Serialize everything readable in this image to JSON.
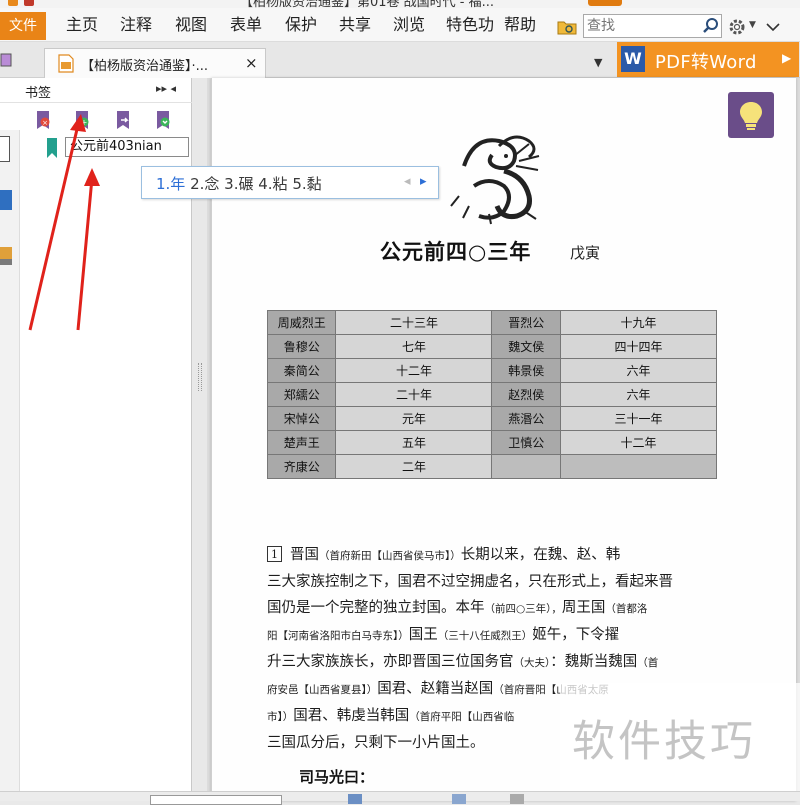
{
  "window": {
    "title_partial": "【柏杨版资治通鉴】第01卷 战国时代 - 福..."
  },
  "menubar": {
    "file": "文件",
    "items": [
      "主页",
      "注释",
      "视图",
      "表单",
      "保护",
      "共享",
      "浏览",
      "特色功",
      "帮助"
    ],
    "search_placeholder": "查找"
  },
  "tabbar": {
    "doc_tab_title": "【柏杨版资治通鉴】·...",
    "close_glyph": "×",
    "pdf_to_word_label": "PDF转Word",
    "word_icon_letter": "W"
  },
  "sidebar": {
    "title": "书签",
    "ctrl_glyphs": "▸▸ ◂",
    "tools": [
      "delete-bookmark-icon",
      "add-bookmark-icon",
      "move-bookmark-icon",
      "expand-bookmark-icon"
    ],
    "bookmark_input_value": "公元前403nian"
  },
  "ime": {
    "first": "1.年",
    "rest": " 2.念 3.碾 4.粘 5.黏",
    "prev": "◂",
    "next": "▸"
  },
  "document": {
    "year_title": "公元前四○三年",
    "ganzhi": "戊寅",
    "rulers": [
      [
        "周威烈王",
        "二十三年",
        "晋烈公",
        "十九年"
      ],
      [
        "鲁穆公",
        "七年",
        "魏文侯",
        "四十四年"
      ],
      [
        "秦简公",
        "十二年",
        "韩景侯",
        "六年"
      ],
      [
        "郑繻公",
        "二十年",
        "赵烈侯",
        "六年"
      ],
      [
        "宋悼公",
        "元年",
        "燕湣公",
        "三十一年"
      ],
      [
        "楚声王",
        "五年",
        "卫慎公",
        "十二年"
      ],
      [
        "齐康公",
        "二年",
        "",
        ""
      ]
    ],
    "paragraph_number": "1",
    "body": {
      "l1a": "晋国",
      "l1b": "（首府新田【山西省侯马市】）",
      "l1c": "长期以来，在魏、赵、韩",
      "l2": "三大家族控制之下，国君不过空拥虚名，只在形式上，看起来晋",
      "l3a": "国仍是一个完整的独立封国。本年",
      "l3b": "（前四○三年），",
      "l3c": "周王国",
      "l3d": "（首都洛",
      "l4a": "阳【河南省洛阳市白马寺东】）",
      "l4b": "国王",
      "l4c": "（三十八任威烈王）",
      "l4d": "姬午，下令擢",
      "l5a": "升三大家族族长，亦即晋国三位国务官",
      "l5b": "（大夫）",
      "l5c": "：魏斯当魏国",
      "l5d": "（首",
      "l6a": "府安邑【山西省夏县】）",
      "l6b": "国君、赵籍当赵国",
      "l6c": "（首府晋阳【山西省太原",
      "l7a": "市】）",
      "l7b": "国君、韩虔当韩国",
      "l7c": "（首府平阳【山西省临",
      "l8": "三国瓜分后，只剩下一小片国土。"
    },
    "author_line": "司马光曰："
  },
  "watermark": "软件技巧",
  "colors": {
    "accent_orange": "#e98417",
    "pdf_button": "#f39322",
    "arrow_red": "#e0221b",
    "ime_blue": "#2d6fd6",
    "tip_purple": "#6a4d89"
  }
}
